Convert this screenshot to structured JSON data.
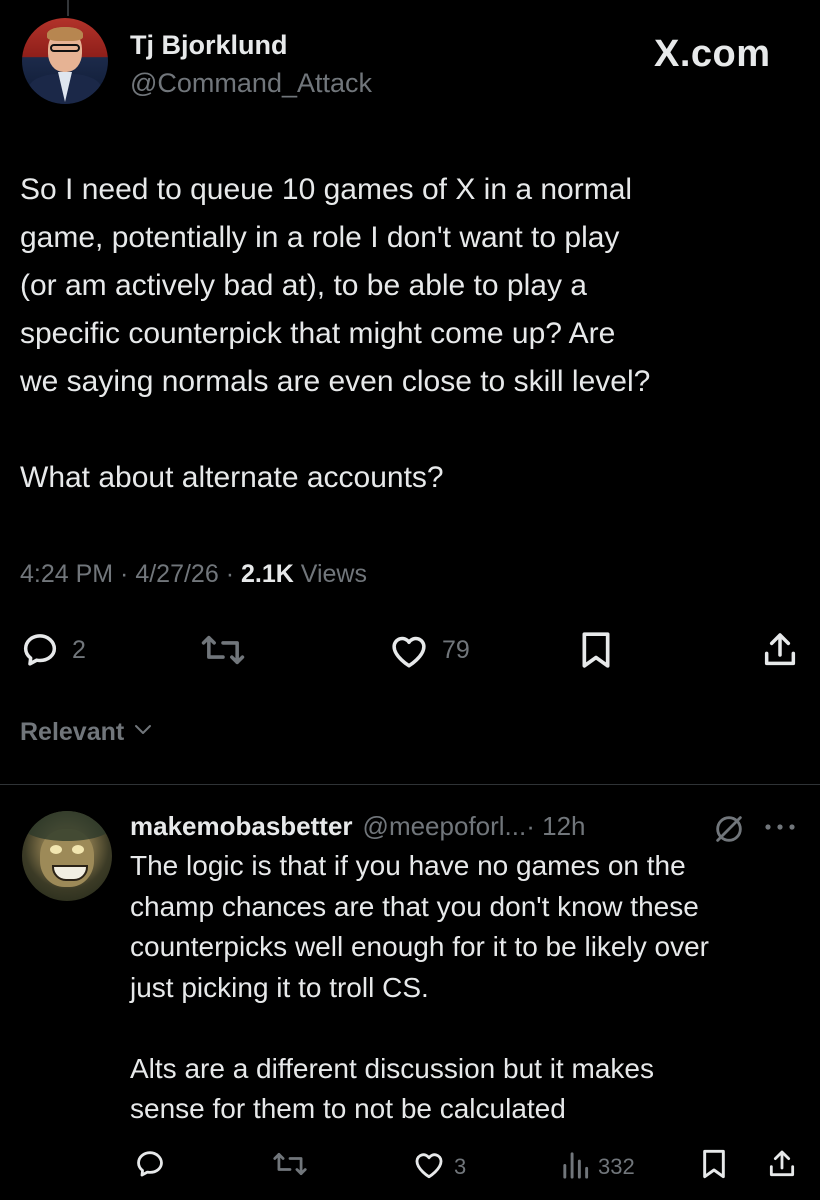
{
  "tweet": {
    "author": {
      "display_name": "Tj Bjorklund",
      "handle": "@Command_Attack"
    },
    "brand": "X.com",
    "text": "So I need to queue 10 games of X in a normal\ngame, potentially in a role I don't want to play\n(or am actively bad at), to be able to play a\nspecific counterpick that might come up? Are\nwe saying normals are even close to skill level?\n\nWhat about alternate accounts?",
    "time": "4:24 PM",
    "date": "4/27/26",
    "separator": " · ",
    "views_count": "2.1K",
    "views_label": " Views",
    "actions": {
      "reply_count": "2",
      "like_count": "79"
    },
    "icons": [
      "reply-icon",
      "retweet-icon",
      "like-icon",
      "bookmark-icon",
      "share-icon"
    ]
  },
  "sort": {
    "label": "Relevant"
  },
  "reply": {
    "author": {
      "display_name": "makemobasbetter",
      "handle": "@meepoforl...",
      "time": " · 12h"
    },
    "text": "The logic is that if you have no games on the\nchamp chances are that you don't know these\ncounterpicks well enough for it to be likely over\njust picking it to troll CS.\n\nAlts are a different discussion but it makes\nsense for them to not be calculated",
    "actions": {
      "like_count": "3",
      "views_count": "332"
    },
    "icons": [
      "grok-icon",
      "more-icon",
      "reply-icon",
      "retweet-icon",
      "like-icon",
      "views-icon",
      "bookmark-icon",
      "share-icon"
    ]
  },
  "colors": {
    "background": "#000000",
    "text": "#e7e9ea",
    "muted": "#71767b",
    "divider": "#2f3336"
  }
}
